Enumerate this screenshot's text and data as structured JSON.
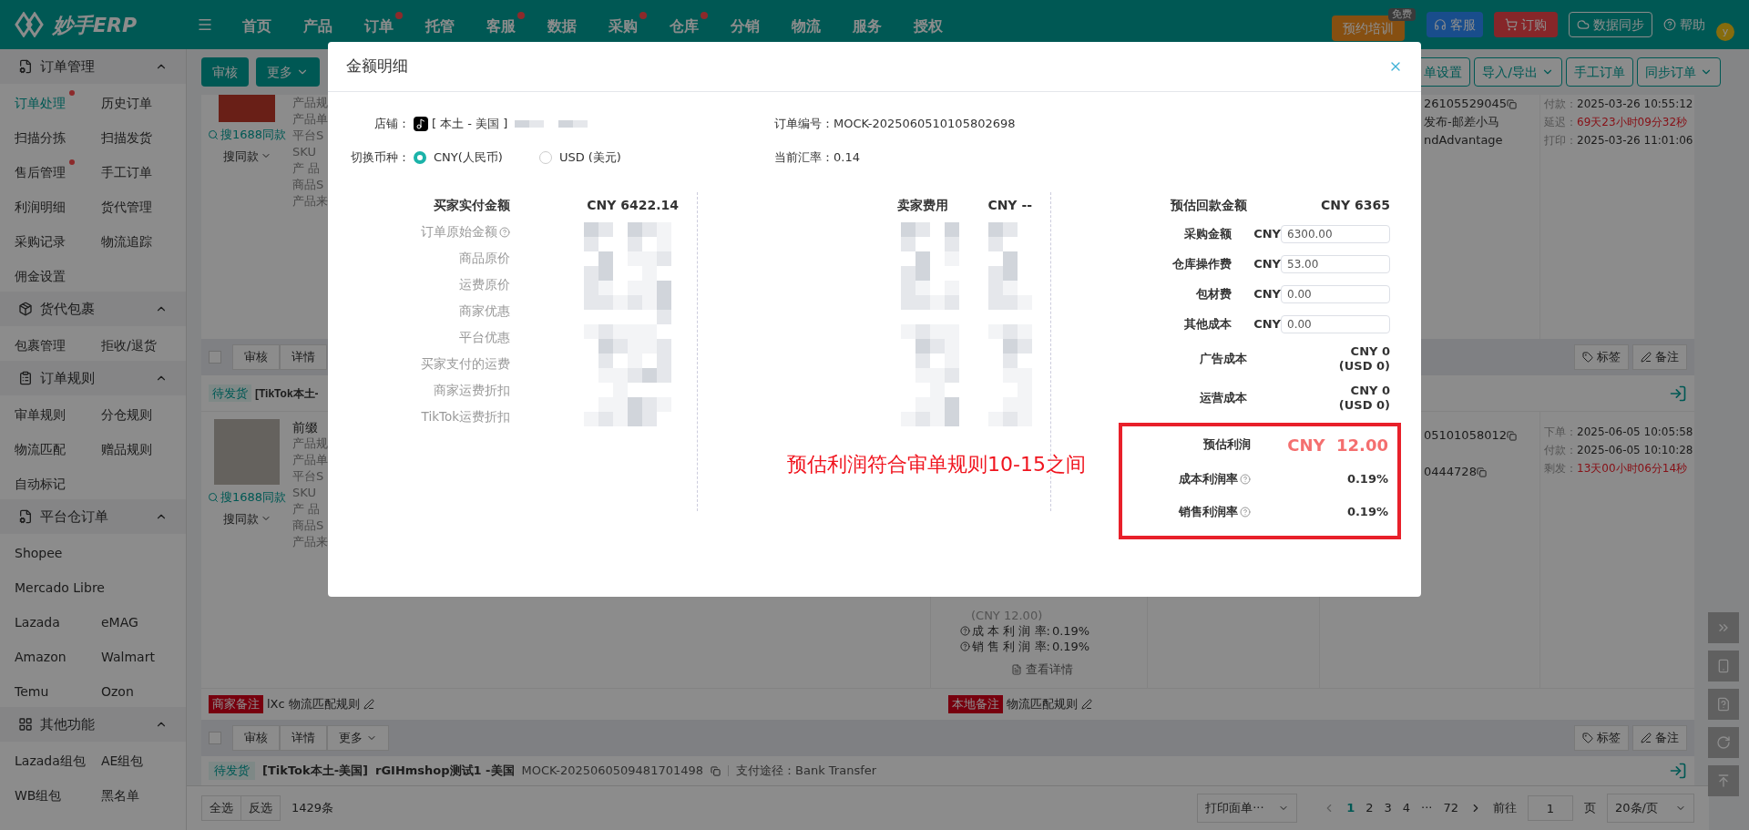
{
  "nav": {
    "logo": "妙手ERP",
    "items": [
      {
        "label": "首页",
        "dot": false
      },
      {
        "label": "产品",
        "dot": false
      },
      {
        "label": "订单",
        "dot": true
      },
      {
        "label": "托管",
        "dot": false
      },
      {
        "label": "客服",
        "dot": true
      },
      {
        "label": "数据",
        "dot": false
      },
      {
        "label": "采购",
        "dot": true
      },
      {
        "label": "仓库",
        "dot": true
      },
      {
        "label": "分销",
        "dot": false
      },
      {
        "label": "物流",
        "dot": false
      },
      {
        "label": "服务",
        "dot": false
      },
      {
        "label": "授权",
        "dot": false
      }
    ],
    "training": {
      "label": "预约培训",
      "badge": "免费"
    },
    "service": "客服",
    "order": "订购",
    "sync": "数据同步",
    "help": "帮助",
    "avatar": "y"
  },
  "sidebar": [
    {
      "title": "订单管理",
      "expanded": true,
      "rows": [
        [
          {
            "label": "订单处理",
            "selected": true,
            "dot": true
          },
          {
            "label": "历史订单",
            "selected": false,
            "dot": false
          }
        ],
        [
          {
            "label": "扫描分拣",
            "selected": false,
            "dot": false
          },
          {
            "label": "扫描发货",
            "selected": false,
            "dot": false
          }
        ],
        [
          {
            "label": "售后管理",
            "selected": false,
            "dot": true
          },
          {
            "label": "手工订单",
            "selected": false,
            "dot": false
          }
        ],
        [
          {
            "label": "利润明细",
            "selected": false,
            "dot": false
          },
          {
            "label": "货代管理",
            "selected": false,
            "dot": false
          }
        ],
        [
          {
            "label": "采购记录",
            "selected": false,
            "dot": false
          },
          {
            "label": "物流追踪",
            "selected": false,
            "dot": false
          }
        ],
        [
          {
            "label": "佣金设置",
            "selected": false,
            "dot": false
          }
        ]
      ]
    },
    {
      "title": "货代包裹",
      "expanded": true,
      "rows": [
        [
          {
            "label": "包裹管理",
            "selected": false,
            "dot": false
          },
          {
            "label": "拒收/退货",
            "selected": false,
            "dot": false
          }
        ]
      ]
    },
    {
      "title": "订单规则",
      "expanded": true,
      "rows": [
        [
          {
            "label": "审单规则",
            "selected": false,
            "dot": false
          },
          {
            "label": "分仓规则",
            "selected": false,
            "dot": false
          }
        ],
        [
          {
            "label": "物流匹配",
            "selected": false,
            "dot": false
          },
          {
            "label": "赠品规则",
            "selected": false,
            "dot": false
          }
        ],
        [
          {
            "label": "自动标记",
            "selected": false,
            "dot": false
          }
        ]
      ]
    },
    {
      "title": "平台仓订单",
      "expanded": true,
      "rows": [
        [
          {
            "label": "Shopee",
            "selected": false,
            "dot": false
          }
        ],
        [
          {
            "label": "Mercado Libre",
            "selected": false,
            "dot": false
          }
        ],
        [
          {
            "label": "Lazada",
            "selected": false,
            "dot": false
          },
          {
            "label": "eMAG",
            "selected": false,
            "dot": false
          }
        ],
        [
          {
            "label": "Amazon",
            "selected": false,
            "dot": false
          },
          {
            "label": "Walmart",
            "selected": false,
            "dot": false
          }
        ],
        [
          {
            "label": "Temu",
            "selected": false,
            "dot": false
          },
          {
            "label": "Ozon",
            "selected": false,
            "dot": false
          }
        ]
      ]
    },
    {
      "title": "其他功能",
      "expanded": true,
      "rows": [
        [
          {
            "label": "Lazada组包",
            "selected": false,
            "dot": false
          },
          {
            "label": "AE组包",
            "selected": false,
            "dot": false
          }
        ],
        [
          {
            "label": "WB组包",
            "selected": false,
            "dot": false
          },
          {
            "label": "黑名单",
            "selected": false,
            "dot": false
          }
        ]
      ]
    }
  ],
  "toolbar": {
    "left": [
      {
        "label": "审核",
        "dropdown": false
      },
      {
        "label": "更多",
        "dropdown": true
      }
    ],
    "right": [
      {
        "label": "单设置",
        "dropdown": false
      },
      {
        "label": "导入/导出",
        "dropdown": true
      },
      {
        "label": "手工订单",
        "dropdown": false
      },
      {
        "label": "同步订单",
        "dropdown": true
      }
    ]
  },
  "order1": {
    "search_same": "搜1688同款",
    "same": "搜同款",
    "fields": [
      "产品规",
      "产品单",
      "平台S",
      "SKU",
      "产 品",
      "商品S",
      "产品来"
    ],
    "col5": [
      "26105529045",
      "发布-邮差小马",
      "ndAdvantage"
    ],
    "dates": [
      {
        "label": "付款：",
        "value": "2025-03-26 10:55:12",
        "alert": false
      },
      {
        "label": "延迟：",
        "value": "69天23小时09分32秒",
        "alert": true
      },
      {
        "label": "打印：",
        "value": "2025-03-26 11:01:06",
        "alert": false
      }
    ]
  },
  "order2": {
    "checked": false,
    "actions": [
      "审核",
      "详情"
    ],
    "tag_btn": "标签",
    "note_btn": "备注",
    "status": "待发货",
    "shop": "[TikTok本土-",
    "title": "前缀",
    "search_same": "搜1688同款",
    "same": "搜同款",
    "fields": [
      "产品规",
      "产品单",
      "平台S",
      "SKU",
      "产 品",
      "商品S",
      "产品来"
    ],
    "profit": "(CNY 12.00)",
    "rates": [
      {
        "label": "成 本 利 润 率:",
        "value": "0.19%"
      },
      {
        "label": "销 售 利 润 率:",
        "value": "0.19%"
      }
    ],
    "detail": "查看详情",
    "col5": [
      "05101058012",
      "0444728"
    ],
    "dates": [
      {
        "label": "下单：",
        "value": "2025-06-05 10:05:58",
        "alert": false
      },
      {
        "label": "付款：",
        "value": "2025-06-05 10:10:28",
        "alert": false
      },
      {
        "label": "剩发：",
        "value": "13天00小时06分14秒",
        "alert": true
      }
    ],
    "remarks": [
      {
        "tag": "商家备注",
        "text": "lXc 物流匹配规则"
      },
      {
        "tag": "本地备注",
        "text": "物流匹配规则"
      }
    ]
  },
  "order3": {
    "checked": false,
    "actions": [
      "审核",
      "详情",
      "更多"
    ],
    "tag_btn": "标签",
    "note_btn": "备注",
    "status": "待发货",
    "shop": "[TikTok本土-美国]",
    "store": "rGIHmshop测试1 -美国",
    "order_no": "MOCK-2025060509481701498",
    "payment": "支付途径：Bank Transfer"
  },
  "footer": {
    "select_all": "全选",
    "invert": "反选",
    "count": "1429条",
    "print": "打印面单···",
    "pages": [
      {
        "label": "1",
        "selected": true
      },
      {
        "label": "2",
        "selected": false
      },
      {
        "label": "3",
        "selected": false
      },
      {
        "label": "4",
        "selected": false
      },
      {
        "label": "···",
        "selected": false
      },
      {
        "label": "72",
        "selected": false
      }
    ],
    "goto": "前往",
    "page_value": "1",
    "page_unit": "页",
    "page_size": "20条/页"
  },
  "modal": {
    "title": "金额明细",
    "store_label": "店铺：",
    "store_region": "[ 本土 - 美国 ]",
    "order_label": "订单编号：",
    "order_no": "MOCK-2025060510105802698",
    "currency_label": "切换币种：",
    "currencies": [
      {
        "label": "CNY(人民币)",
        "selected": true
      },
      {
        "label": "USD (美元)",
        "selected": false
      }
    ],
    "rate_label": "当前汇率：",
    "rate": "0.14",
    "buyer": {
      "title": "买家实付金额",
      "total": "CNY 6422.14",
      "rows": [
        {
          "label": "订单原始金额",
          "help": true
        },
        {
          "label": "商品原价",
          "help": false
        },
        {
          "label": "运费原价",
          "help": false
        },
        {
          "label": "商家优惠",
          "help": false
        },
        {
          "label": "平台优惠",
          "help": false
        },
        {
          "label": "买家支付的运费",
          "help": false
        },
        {
          "label": "商家运费折扣",
          "help": false
        },
        {
          "label": "TikTok运费折扣",
          "help": false
        }
      ]
    },
    "seller": {
      "title": "卖家费用",
      "total": "CNY --"
    },
    "payout": {
      "title": "预估回款金额",
      "total": "CNY 6365",
      "rows": [
        {
          "kind": "input",
          "label": "采购金额",
          "currency": "CNY",
          "value": "6300.00"
        },
        {
          "kind": "input",
          "label": "仓库操作费",
          "currency": "CNY",
          "value": "53.00"
        },
        {
          "kind": "input",
          "label": "包材费",
          "currency": "CNY",
          "value": "0.00"
        },
        {
          "kind": "input",
          "label": "其他成本",
          "currency": "CNY",
          "value": "0.00"
        },
        {
          "kind": "dual",
          "label": "广告成本",
          "main": "CNY 0",
          "sub": "(USD 0)"
        },
        {
          "kind": "dual",
          "label": "运营成本",
          "main": "CNY 0",
          "sub": "(USD 0)"
        }
      ]
    },
    "profit": {
      "label": "预估利润",
      "value": "CNY  12.00",
      "rates": [
        {
          "label": "成本利润率",
          "value": "0.19%",
          "help": true
        },
        {
          "label": "销售利润率",
          "value": "0.19%",
          "help": true
        }
      ]
    },
    "annotation": "预估利润符合审单规则10-15之间"
  }
}
